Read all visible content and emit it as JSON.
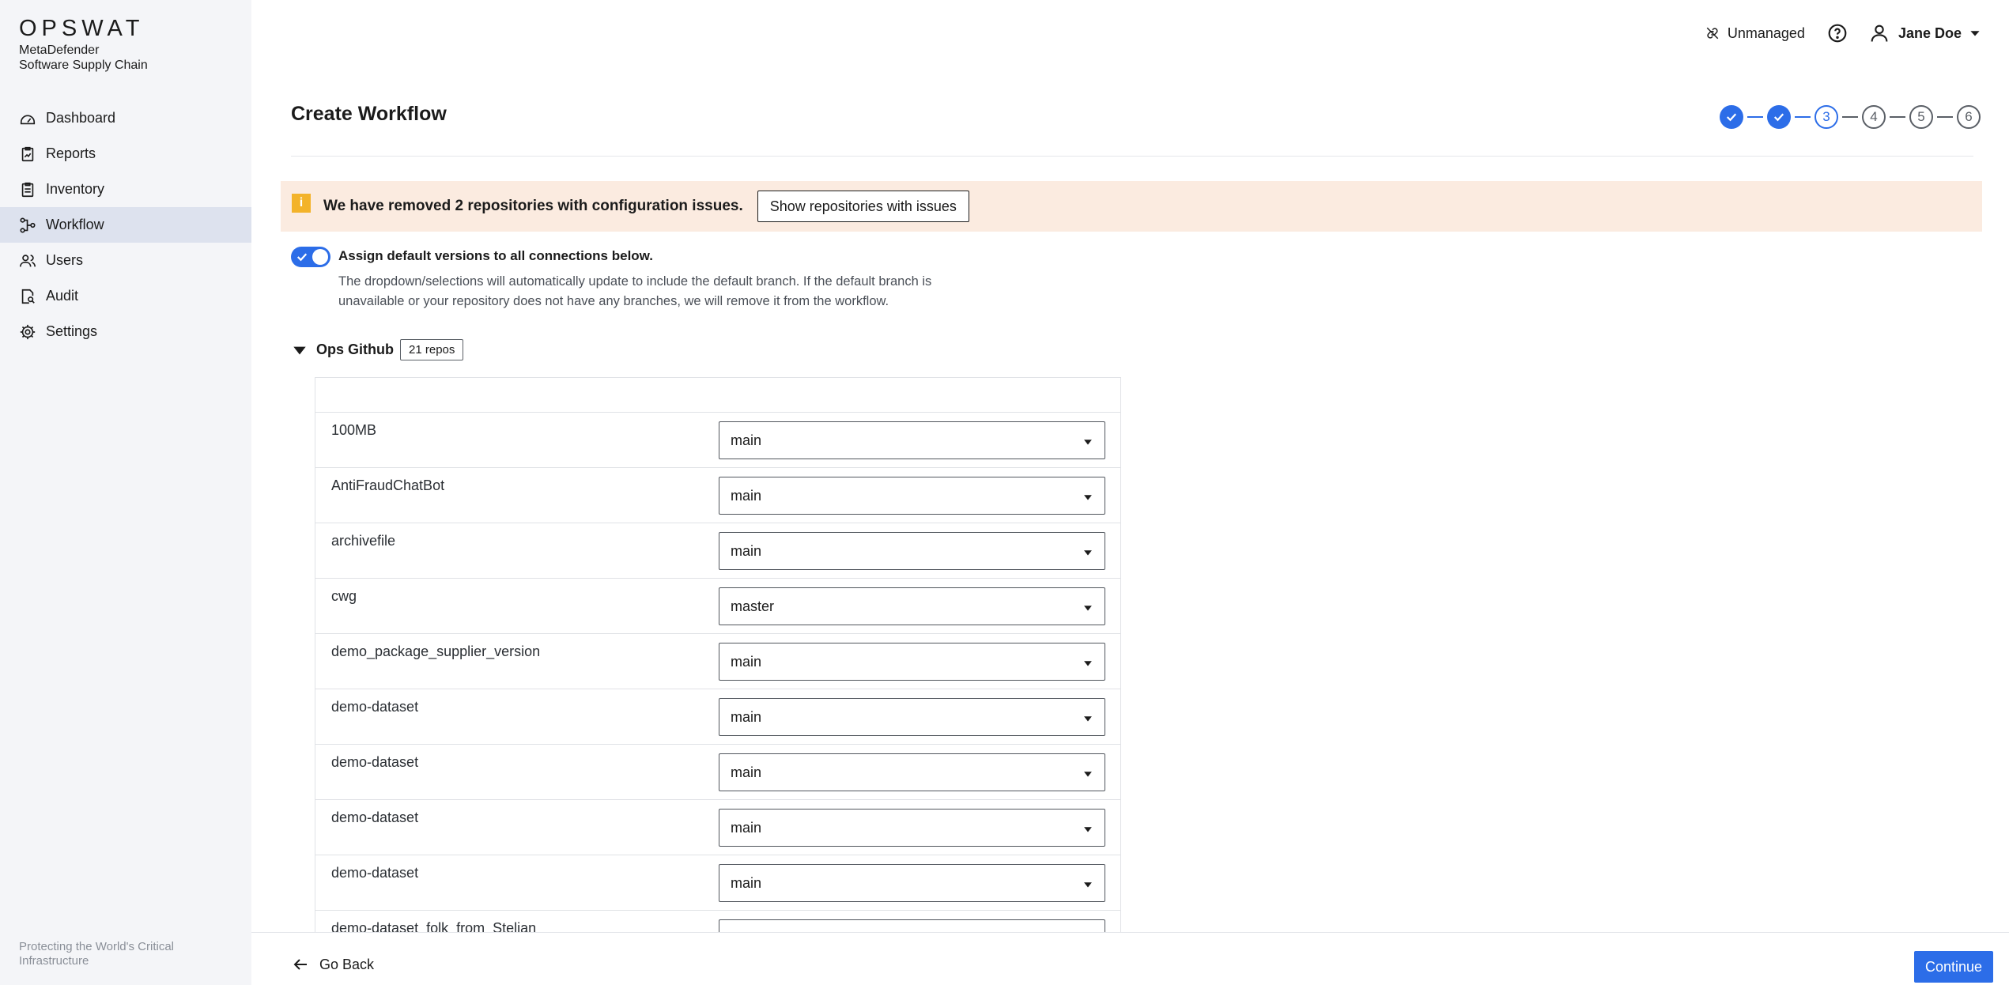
{
  "brand": {
    "logo_text": "OPSWAT",
    "product_line1": "MetaDefender",
    "product_line2": "Software Supply Chain"
  },
  "sidebar": {
    "items": [
      {
        "label": "Dashboard",
        "icon": "dashboard-icon"
      },
      {
        "label": "Reports",
        "icon": "reports-icon"
      },
      {
        "label": "Inventory",
        "icon": "inventory-icon"
      },
      {
        "label": "Workflow",
        "icon": "workflow-icon",
        "active": true
      },
      {
        "label": "Users",
        "icon": "users-icon"
      },
      {
        "label": "Audit",
        "icon": "audit-icon"
      },
      {
        "label": "Settings",
        "icon": "settings-icon"
      }
    ],
    "footer": "Protecting the World's Critical Infrastructure"
  },
  "topbar": {
    "unmanaged_label": "Unmanaged",
    "user_name": "Jane Doe"
  },
  "header": {
    "title": "Create Workflow",
    "steps": [
      "✓",
      "✓",
      "3",
      "4",
      "5",
      "6"
    ],
    "current_step": 3
  },
  "banner": {
    "message": "We have removed 2 repositories with configuration issues.",
    "button_label": "Show repositories with issues"
  },
  "default_versions": {
    "enabled": true,
    "label": "Assign default versions to all connections below.",
    "description": "The dropdown/selections will automatically update to include the default branch. If the default branch is unavailable or your repository does not have any branches, we will remove it from the workflow."
  },
  "group": {
    "name": "Ops Github",
    "badge": "21 repos"
  },
  "repos": [
    {
      "name": "100MB",
      "branch": "main"
    },
    {
      "name": "AntiFraudChatBot",
      "branch": "main"
    },
    {
      "name": "archivefile",
      "branch": "main"
    },
    {
      "name": "cwg",
      "branch": "master"
    },
    {
      "name": "demo_package_supplier_version",
      "branch": "main"
    },
    {
      "name": "demo-dataset",
      "branch": "main"
    },
    {
      "name": "demo-dataset",
      "branch": "main"
    },
    {
      "name": "demo-dataset",
      "branch": "main"
    },
    {
      "name": "demo-dataset",
      "branch": "main"
    },
    {
      "name": "demo-dataset_folk_from_Stelian",
      "branch": ""
    }
  ],
  "footer": {
    "back_label": "Go Back",
    "continue_label": "Continue"
  },
  "colors": {
    "accent": "#2c6de8",
    "banner_bg": "#fbebe0",
    "warning_icon": "#f3b32a",
    "sidebar_bg": "#f4f5f8"
  }
}
